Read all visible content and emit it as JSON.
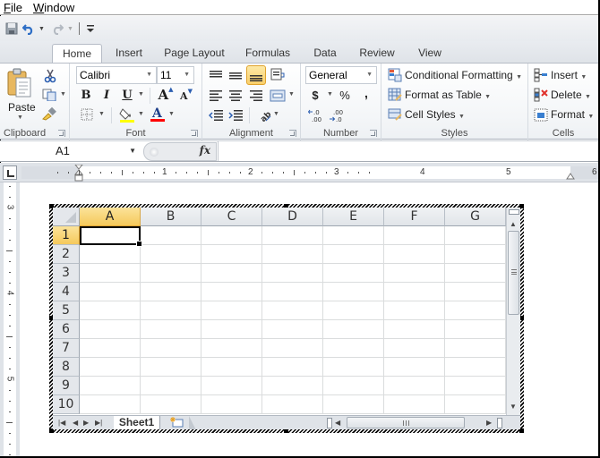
{
  "menu": [
    {
      "label": "File",
      "accel": "F",
      "rest": "ile"
    },
    {
      "label": "Window",
      "accel": "W",
      "rest": "indow"
    }
  ],
  "qat": {
    "icons": [
      "save-icon",
      "undo-icon",
      "redo-icon",
      "customize-qat-icon"
    ]
  },
  "tabs": [
    "Home",
    "Insert",
    "Page Layout",
    "Formulas",
    "Data",
    "Review",
    "View"
  ],
  "active_tab": "Home",
  "ribbon": {
    "clipboard": {
      "label": "Clipboard",
      "paste": "Paste",
      "icons": [
        "cut-icon",
        "copy-icon",
        "format-painter-icon"
      ]
    },
    "font": {
      "label": "Font",
      "font_name": "Calibri",
      "font_size": "11",
      "bold": "B",
      "italic": "I",
      "underline": "U",
      "grow": "A",
      "shrink": "A",
      "fill_color": "#ffff00",
      "font_color": "#ff0000"
    },
    "alignment": {
      "label": "Alignment",
      "active": "bottom-align"
    },
    "number": {
      "label": "Number",
      "format": "General",
      "currency": "$",
      "percent": "%",
      "comma": ",",
      "inc_decimal": ".0 .00",
      "dec_decimal": ".00 .0"
    },
    "styles": {
      "label": "Styles",
      "conditional": "Conditional Formatting",
      "format_table": "Format as Table",
      "cell_styles": "Cell Styles"
    },
    "cells": {
      "label": "Cells",
      "insert": "Insert",
      "delete": "Delete",
      "format": "Format"
    }
  },
  "formula_bar": {
    "name_box": "A1",
    "fx": "fx",
    "formula": ""
  },
  "ruler": {
    "h_numbers": [
      "1",
      "2",
      "3",
      "4",
      "5",
      "6"
    ],
    "v_numbers": [
      "3",
      "4",
      "5"
    ]
  },
  "sheet": {
    "columns": [
      "A",
      "B",
      "C",
      "D",
      "E",
      "F",
      "G"
    ],
    "rows": [
      "1",
      "2",
      "3",
      "4",
      "5",
      "6",
      "7",
      "8",
      "9",
      "10"
    ],
    "active_cell": "A1",
    "tab_name": "Sheet1"
  },
  "colors": {
    "selected_header": "#f5c95b",
    "ribbon_bg": "#f4f6f8"
  }
}
